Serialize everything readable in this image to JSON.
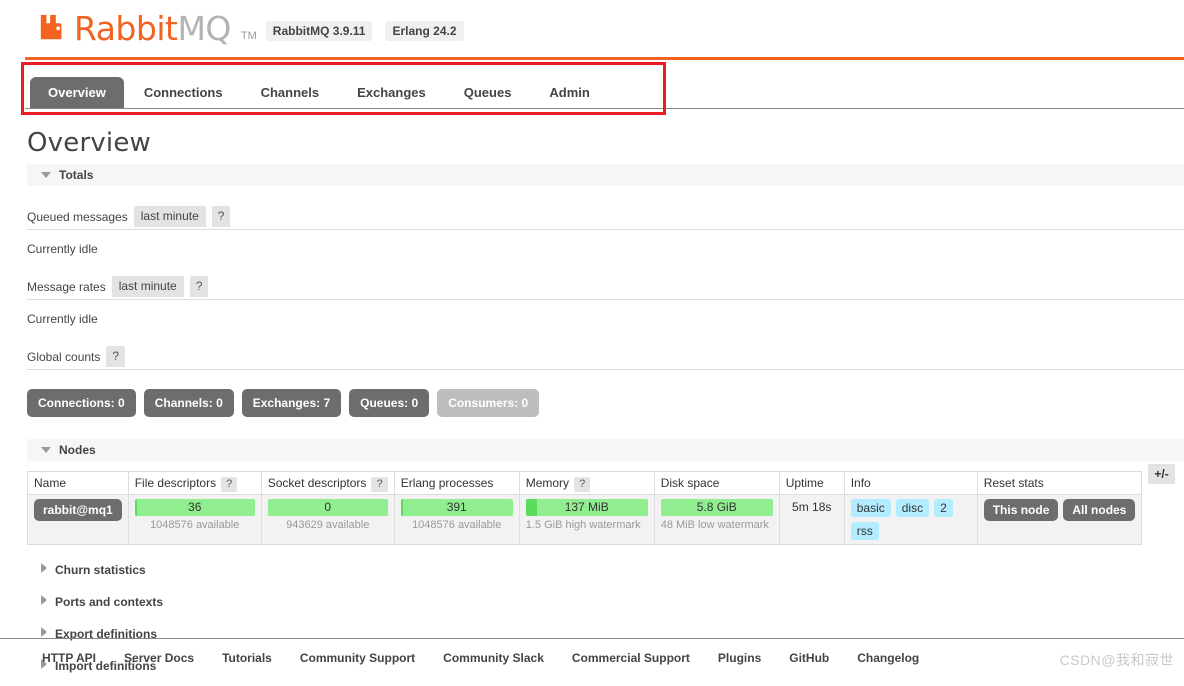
{
  "header": {
    "logo_mark": "rabbitmq-logo-icon",
    "brand_primary": "Rabbit",
    "brand_secondary": "MQ",
    "trademark": "TM",
    "version_rabbitmq": "RabbitMQ 3.9.11",
    "version_erlang": "Erlang 24.2",
    "brand_color": "#f26322"
  },
  "nav": {
    "tabs": [
      {
        "label": "Overview",
        "active": true
      },
      {
        "label": "Connections",
        "active": false
      },
      {
        "label": "Channels",
        "active": false
      },
      {
        "label": "Exchanges",
        "active": false
      },
      {
        "label": "Queues",
        "active": false
      },
      {
        "label": "Admin",
        "active": false
      }
    ],
    "annotation_color": "#ed1c24"
  },
  "page": {
    "title": "Overview"
  },
  "totals": {
    "section_label": "Totals",
    "queued_messages": {
      "label": "Queued messages",
      "period": "last minute",
      "help": "?",
      "status": "Currently idle"
    },
    "message_rates": {
      "label": "Message rates",
      "period": "last minute",
      "help": "?",
      "status": "Currently idle"
    },
    "global_counts": {
      "label": "Global counts",
      "help": "?",
      "buttons": [
        {
          "label": "Connections:",
          "value": "0",
          "muted": false
        },
        {
          "label": "Channels:",
          "value": "0",
          "muted": false
        },
        {
          "label": "Exchanges:",
          "value": "7",
          "muted": false
        },
        {
          "label": "Queues:",
          "value": "0",
          "muted": false
        },
        {
          "label": "Consumers:",
          "value": "0",
          "muted": true
        }
      ]
    }
  },
  "nodes": {
    "section_label": "Nodes",
    "columns": [
      {
        "label": "Name",
        "help": null
      },
      {
        "label": "File descriptors",
        "help": "?"
      },
      {
        "label": "Socket descriptors",
        "help": "?"
      },
      {
        "label": "Erlang processes",
        "help": null
      },
      {
        "label": "Memory",
        "help": "?"
      },
      {
        "label": "Disk space",
        "help": null
      },
      {
        "label": "Uptime",
        "help": null
      },
      {
        "label": "Info",
        "help": null
      },
      {
        "label": "Reset stats",
        "help": null
      }
    ],
    "expand_toggle": "+/-",
    "row": {
      "name": "rabbit@mq1",
      "file_descriptors": {
        "value": "36",
        "sub": "1048576 available",
        "fill_pct": 1
      },
      "socket_descriptors": {
        "value": "0",
        "sub": "943629 available",
        "fill_pct": 0
      },
      "erlang_processes": {
        "value": "391",
        "sub": "1048576 available",
        "fill_pct": 1
      },
      "memory": {
        "value": "137 MiB",
        "sub": "1.5 GiB high watermark",
        "fill_pct": 9
      },
      "disk_space": {
        "value": "5.8 GiB",
        "sub": "48 MiB low watermark",
        "fill_pct": 0
      },
      "uptime": "5m 18s",
      "info": [
        "basic",
        "disc",
        "2",
        "rss"
      ],
      "reset_stats": [
        "This node",
        "All nodes"
      ]
    }
  },
  "collapsed_sections": [
    {
      "label": "Churn statistics"
    },
    {
      "label": "Ports and contexts"
    },
    {
      "label": "Export definitions"
    },
    {
      "label": "Import definitions"
    }
  ],
  "footer": {
    "links": [
      "HTTP API",
      "Server Docs",
      "Tutorials",
      "Community Support",
      "Community Slack",
      "Commercial Support",
      "Plugins",
      "GitHub",
      "Changelog"
    ],
    "watermark": "CSDN@我和寂世"
  }
}
